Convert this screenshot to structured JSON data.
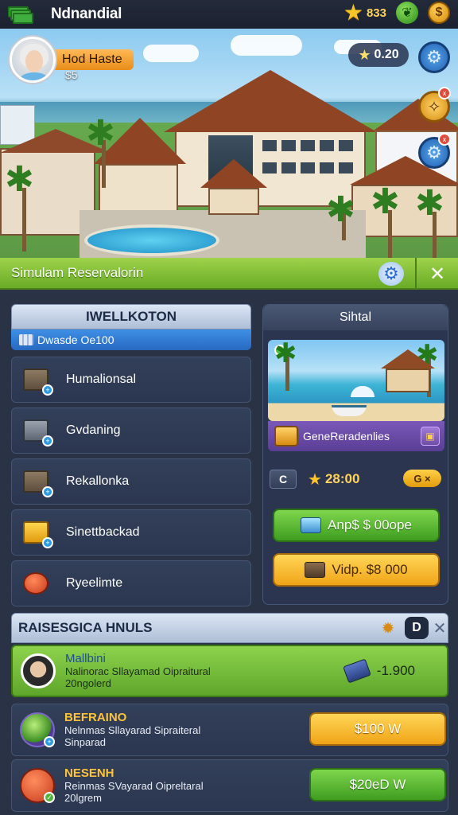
{
  "topbar": {
    "title": "Ndnandial",
    "stars_value": "833",
    "money_icon": "cash-stack-icon",
    "leaf_icon": "leaf-icon",
    "coin_icon": "coin-icon"
  },
  "hero": {
    "player_name": "Hod Haste",
    "player_price": "$5",
    "rating": "0.20",
    "compass_badge": "x",
    "gear_badge": "x"
  },
  "sim_bar": {
    "title": "Simulam Reservalorin",
    "close": "✕"
  },
  "left_panel": {
    "tab_title": "IWELLKOTON",
    "tab_sub": "Dwasde Oe100",
    "items": [
      {
        "label": "Humalionsal",
        "icon": "crate-icon"
      },
      {
        "label": "Gvdaning",
        "icon": "machine-icon"
      },
      {
        "label": "Rekallonka",
        "icon": "crate-icon"
      },
      {
        "label": "Sinettbackad",
        "icon": "gold-box-icon"
      },
      {
        "label": "Ryeelimte",
        "icon": "red-orb-icon"
      }
    ]
  },
  "right_panel": {
    "title": "Sihtal",
    "caption": "GeneReradenlies",
    "c_label": "C",
    "score": "28:00",
    "g_pill": "G ×",
    "btn_green": "Anp$ $ 00ope",
    "btn_orange": "Vidp. $8 000"
  },
  "bottom": {
    "title": "RAISESGICA HNULS",
    "d_label": "D",
    "close": "✕",
    "rows": [
      {
        "name": "Mallbini",
        "line1": "Nalinorac Sllayamad Oipraitural",
        "line2": "20ngolerd",
        "value": "-1.900"
      },
      {
        "name": "BEFRAINO",
        "line1": "Nelnmas Sllayarad Sipraiteral",
        "line2": "Sinparad",
        "button": "$100 W"
      },
      {
        "name": "NESENH",
        "line1": "Reinmas SVayarad Oipreltaral",
        "line2": "20lgrem",
        "button": "$20eD W"
      }
    ]
  },
  "colors": {
    "accent_green": "#6aab27",
    "accent_orange": "#f0a418",
    "panel_bg": "#2c3550",
    "tab_blue": "#2769c1"
  }
}
